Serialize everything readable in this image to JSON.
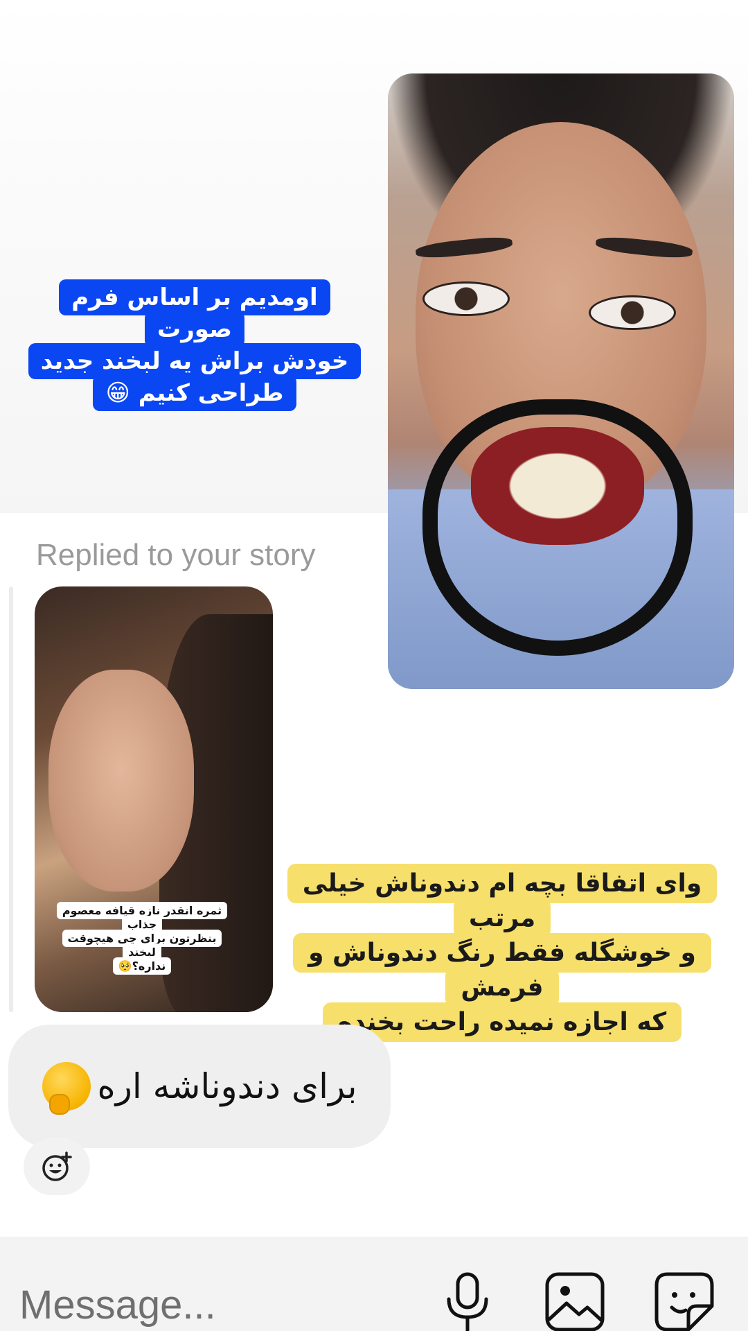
{
  "thread": {
    "story_caption_lines": [
      "اومدیم بر اساس فرم صورت",
      "خودش براش یه لبخند جدید",
      "طراحی کنیم 😁"
    ],
    "replied_label": "Replied to your story",
    "story_text_lines": [
      "ثمره انقدر نازه قیافه معصوم جذاب",
      "بنظرتون برای چی هیچوقت لبخند",
      "نداره؟🥺"
    ],
    "story_reply_caption_lines": [
      "وای اتفاقا بچه ام دندوناش خیلی مرتب",
      "و خوشگله فقط رنگ دندوناش و فرمش",
      "که اجازه نمیده راحت بخنده"
    ],
    "message_text": "برای دندوناشه اره"
  },
  "composer": {
    "placeholder": "Message...",
    "icons": [
      "microphone-icon",
      "image-icon",
      "sticker-icon"
    ]
  },
  "icons": {
    "react": "add-reaction-icon",
    "message_emoji": "thinking-face-icon"
  }
}
